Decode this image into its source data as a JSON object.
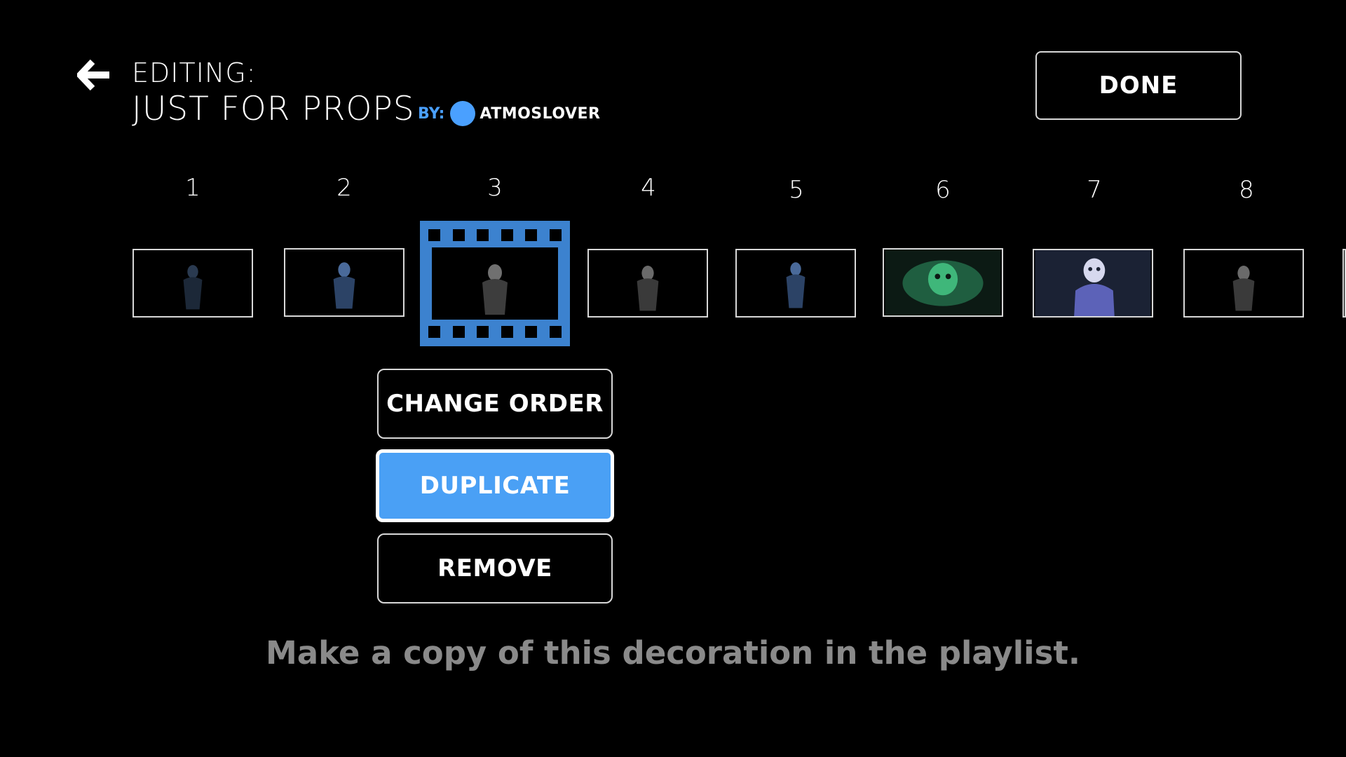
{
  "header": {
    "editing_label": "EDITING:",
    "playlist_title": "JUST FOR PROPS",
    "by_label": "BY:",
    "author": "ATMOSLOVER",
    "done_label": "DONE",
    "accent_color": "#4aa0ff"
  },
  "timeline": {
    "slots": [
      {
        "number": "1",
        "content": "hooded-figure-dark"
      },
      {
        "number": "2",
        "content": "hooded-figure-blue"
      },
      {
        "number": "3",
        "content": "witch-figure",
        "selected": true
      },
      {
        "number": "4",
        "content": "witch-figure"
      },
      {
        "number": "5",
        "content": "hooded-figure-blue"
      },
      {
        "number": "6",
        "content": "green-ghost"
      },
      {
        "number": "7",
        "content": "blue-phantom"
      },
      {
        "number": "8",
        "content": "witch-figure"
      }
    ],
    "selected_icon": "film-strip-icon"
  },
  "menu": {
    "change_order": "CHANGE ORDER",
    "duplicate": "DUPLICATE",
    "remove": "REMOVE",
    "focused": "duplicate",
    "focus_color": "#4aa0f5"
  },
  "hint": "Make a copy of this decoration in the playlist."
}
